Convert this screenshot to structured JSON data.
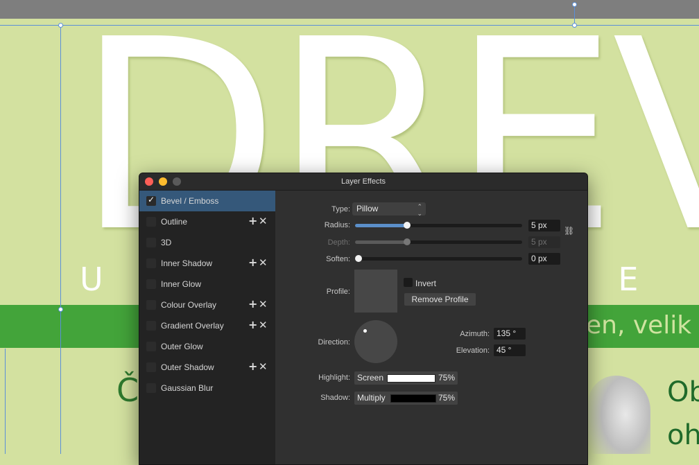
{
  "canvas": {
    "big_title": "DREV",
    "subtitle_left": "U S",
    "subtitle_right": "D O E",
    "band_text": "en, velik",
    "body_left": "Č",
    "body_right_1": "Ob",
    "body_right_2": "oh",
    "colors": {
      "background": "#d3e1a0",
      "band": "#43a43a"
    }
  },
  "dialog": {
    "title": "Layer Effects",
    "effects": [
      {
        "label": "Bevel / Emboss",
        "checked": true,
        "selected": true,
        "addable": false
      },
      {
        "label": "Outline",
        "checked": false,
        "selected": false,
        "addable": true
      },
      {
        "label": "3D",
        "checked": false,
        "selected": false,
        "addable": false
      },
      {
        "label": "Inner Shadow",
        "checked": false,
        "selected": false,
        "addable": true
      },
      {
        "label": "Inner Glow",
        "checked": false,
        "selected": false,
        "addable": false
      },
      {
        "label": "Colour Overlay",
        "checked": false,
        "selected": false,
        "addable": true
      },
      {
        "label": "Gradient Overlay",
        "checked": false,
        "selected": false,
        "addable": true
      },
      {
        "label": "Outer Glow",
        "checked": false,
        "selected": false,
        "addable": false
      },
      {
        "label": "Outer Shadow",
        "checked": false,
        "selected": false,
        "addable": true
      },
      {
        "label": "Gaussian Blur",
        "checked": false,
        "selected": false,
        "addable": false
      }
    ],
    "add_icon": "+",
    "remove_icon": "✕",
    "settings": {
      "type_label": "Type:",
      "type_value": "Pillow",
      "radius_label": "Radius:",
      "radius_value": "5 px",
      "radius_fraction": 0.31,
      "depth_label": "Depth:",
      "depth_value": "5 px",
      "depth_fraction": 0.31,
      "soften_label": "Soften:",
      "soften_value": "0 px",
      "soften_fraction": 0.0,
      "profile_label": "Profile:",
      "invert_label": "Invert",
      "remove_profile_label": "Remove Profile",
      "direction_label": "Direction:",
      "azimuth_label": "Azimuth:",
      "azimuth_value": "135 °",
      "elevation_label": "Elevation:",
      "elevation_value": "45 °",
      "highlight_label": "Highlight:",
      "highlight_mode": "Screen",
      "highlight_color": "#ffffff",
      "highlight_opacity": "75%",
      "shadow_label": "Shadow:",
      "shadow_mode": "Multiply",
      "shadow_color": "#000000",
      "shadow_opacity": "75%"
    }
  }
}
